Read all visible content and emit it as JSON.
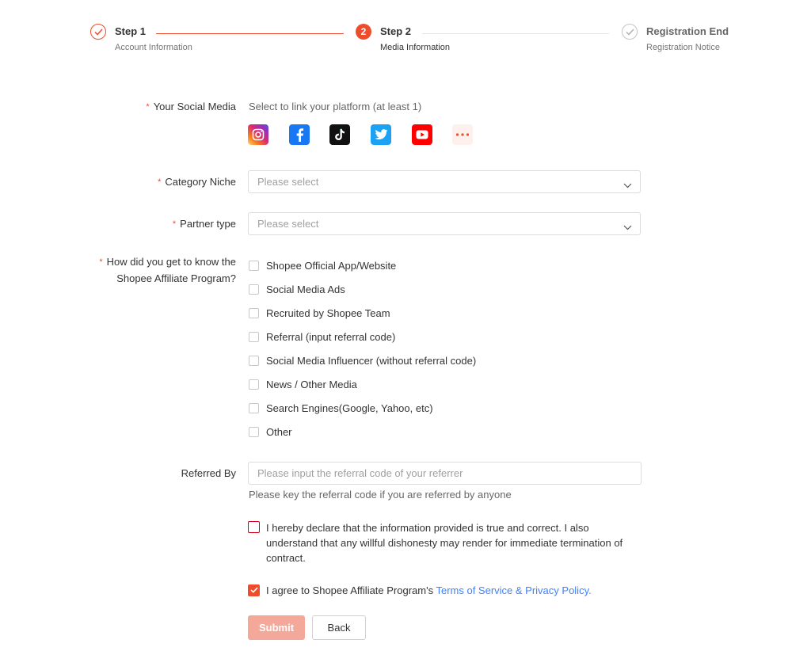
{
  "stepper": {
    "steps": [
      {
        "title": "Step 1",
        "subtitle": "Account Information",
        "state": "done"
      },
      {
        "title": "Step 2",
        "subtitle": "Media Information",
        "number": "2",
        "state": "active"
      },
      {
        "title": "Registration End",
        "subtitle": "Registration Notice",
        "state": "pending"
      }
    ]
  },
  "form": {
    "social_media": {
      "label": "Your Social Media",
      "hint": "Select to link your platform (at least 1)",
      "platforms": [
        "instagram-icon",
        "facebook-icon",
        "tiktok-icon",
        "twitter-icon",
        "youtube-icon",
        "more-icon"
      ]
    },
    "category_niche": {
      "label": "Category Niche",
      "placeholder": "Please select"
    },
    "partner_type": {
      "label": "Partner type",
      "placeholder": "Please select"
    },
    "source": {
      "label_line1": "How did you get to know the",
      "label_line2": "Shopee Affiliate Program?",
      "options": [
        "Shopee Official App/Website",
        "Social Media Ads",
        "Recruited by Shopee Team",
        "Referral (input referral code)",
        "Social Media Influencer (without referral code)",
        "News / Other Media",
        "Search Engines(Google, Yahoo, etc)",
        "Other"
      ]
    },
    "referred_by": {
      "label": "Referred By",
      "placeholder": "Please input the referral code of your referrer",
      "value": "",
      "hint": "Please key the referral code if you are referred by anyone"
    },
    "declaration": "I hereby declare that the information provided is true and correct. I also understand that any willful dishonesty may render for immediate termination of contract.",
    "agree": {
      "prefix": "I agree to Shopee Affiliate Program's ",
      "link": "Terms of Service & Privacy Policy",
      "suffix": "."
    },
    "required_mark": "*",
    "submit_label": "Submit",
    "back_label": "Back"
  },
  "colors": {
    "accent": "#ee4d2d",
    "link": "#4080ff",
    "submit_disabled": "#f4a899"
  }
}
